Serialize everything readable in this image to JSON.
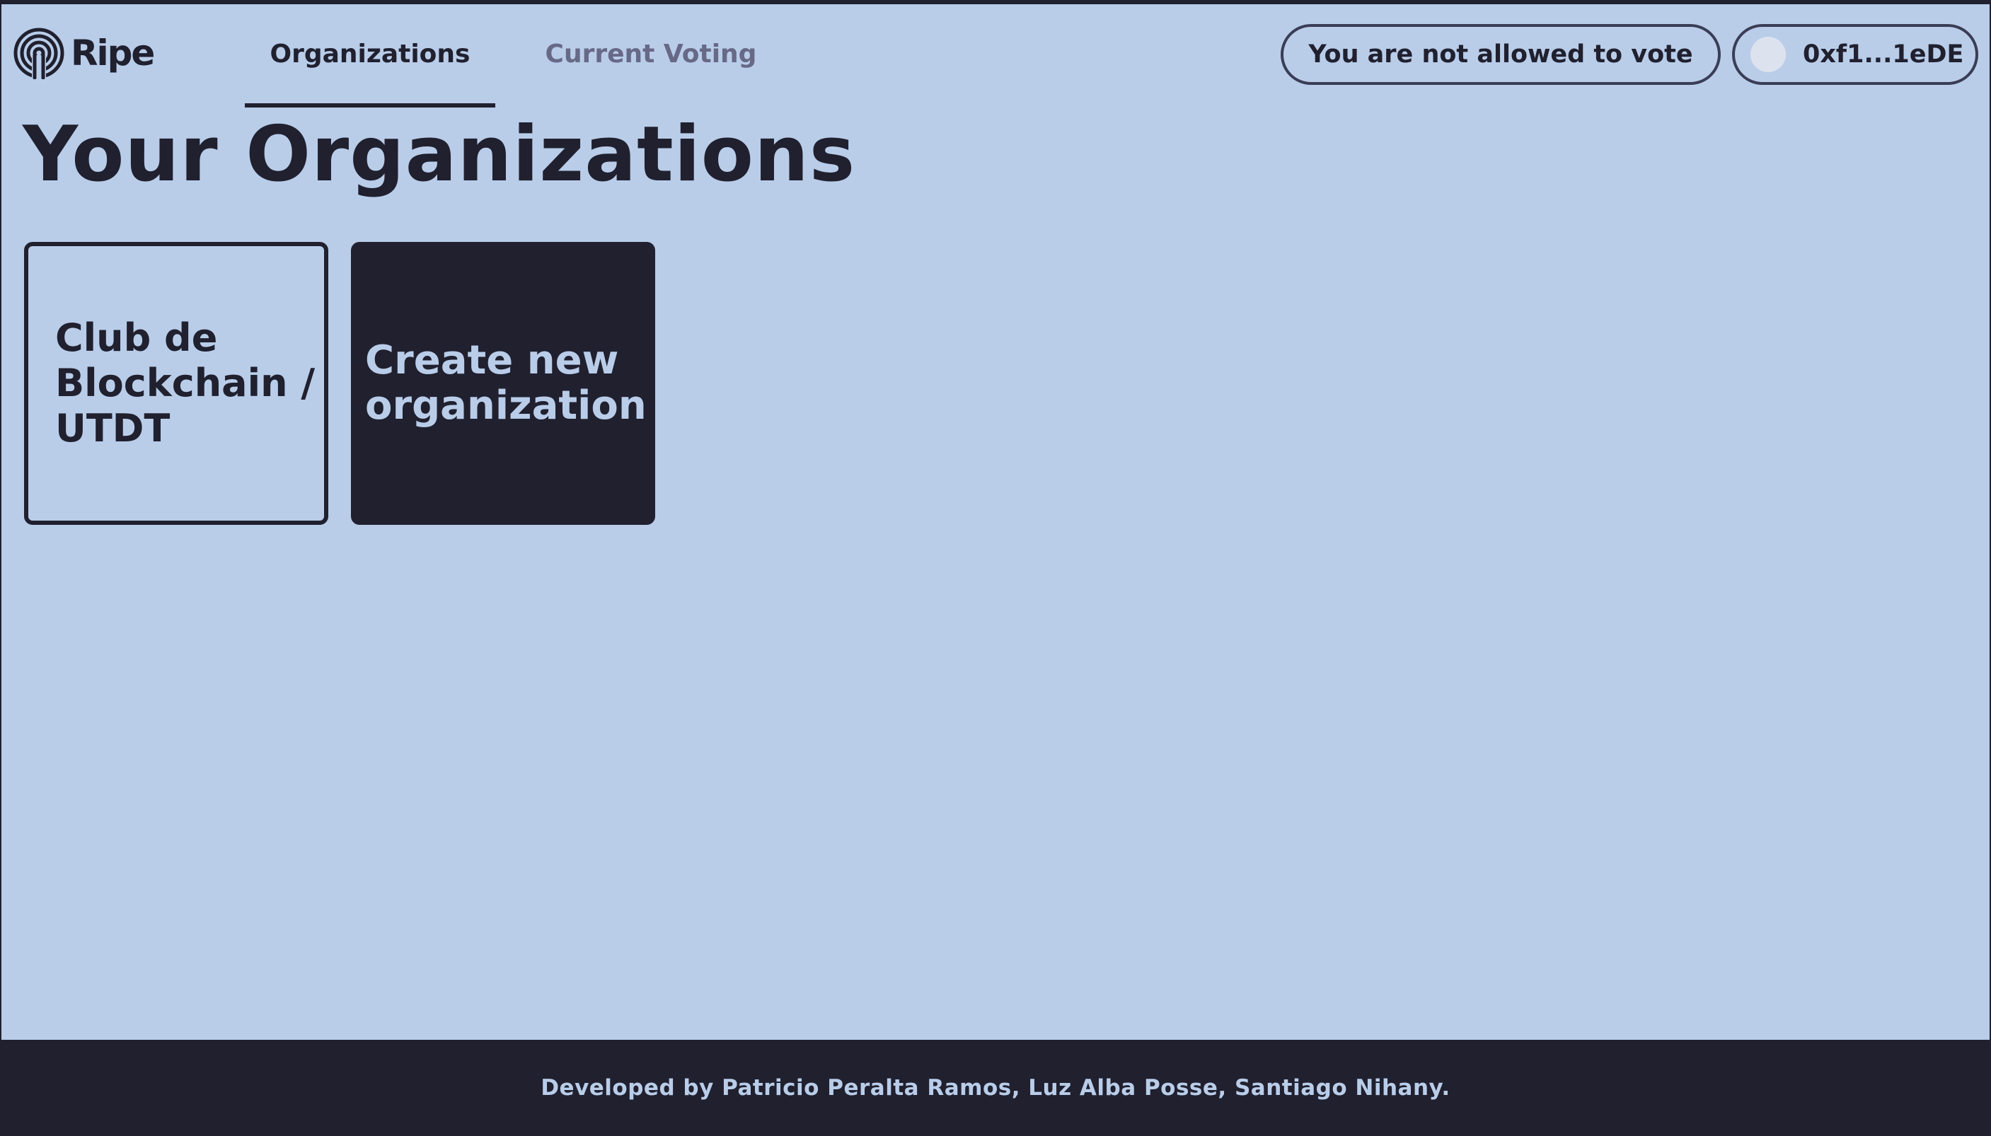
{
  "app": {
    "logo_text": "Ripe",
    "logo_icon": "fingerprint-icon"
  },
  "nav": {
    "tabs": [
      {
        "label": "Organizations",
        "active": true
      },
      {
        "label": "Current Voting",
        "active": false
      }
    ]
  },
  "header": {
    "vote_status": "You are not allowed to vote",
    "wallet_address": "0xf1...1eDE"
  },
  "page": {
    "title": "Your Organizations"
  },
  "organizations": [
    {
      "name": "Club de Blockchain / UTDT"
    }
  ],
  "create_card": {
    "label": "Create new organization"
  },
  "footer": {
    "credits": "Developed by Patricio Peralta Ramos, Luz Alba Posse, Santiago Nihany."
  },
  "colors": {
    "background": "#b9cde9",
    "dark": "#20202f",
    "inactive_tab": "#676986",
    "avatar": "#dde3ee"
  }
}
